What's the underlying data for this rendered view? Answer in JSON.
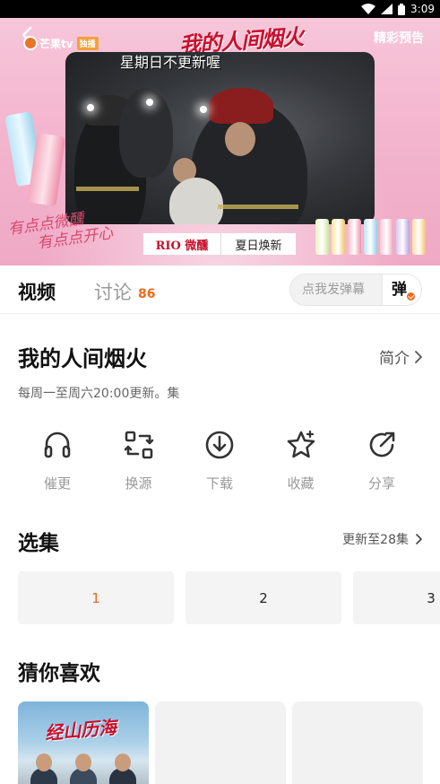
{
  "status_bar": {
    "time": "3:09"
  },
  "player": {
    "logo_text": "芒果tv",
    "logo_badge": "独播",
    "title_art": "我的人间烟火",
    "preview_label": "精彩预告",
    "subtitle": "星期日不更新喔",
    "ad_brand": "RIO 微醺",
    "ad_text": "夏日焕新",
    "slogan_line1": "有点点微醺",
    "slogan_line2": "有点点开心"
  },
  "tabs": {
    "video_label": "视频",
    "discuss_label": "讨论",
    "discuss_count": "86",
    "danmaku_placeholder": "点我发弹幕",
    "danmaku_toggle": "弹"
  },
  "show": {
    "title": "我的人间烟火",
    "intro_label": "简介",
    "schedule": "每周一至周六20:00更新。集"
  },
  "actions": [
    {
      "label": "催更",
      "icon": "headphones-icon"
    },
    {
      "label": "换源",
      "icon": "switch-source-icon"
    },
    {
      "label": "下载",
      "icon": "download-icon"
    },
    {
      "label": "收藏",
      "icon": "star-icon"
    },
    {
      "label": "分享",
      "icon": "share-icon"
    }
  ],
  "episodes": {
    "title": "选集",
    "update_text": "更新至28集",
    "items": [
      "1",
      "2",
      "3"
    ]
  },
  "recommend": {
    "title": "猜你喜欢",
    "cards": [
      {
        "poster_title": "经山历海"
      }
    ]
  },
  "colors": {
    "accent": "#ef6a1b",
    "poster_red": "#c8102e",
    "player_pink": "#f3b4cd"
  }
}
